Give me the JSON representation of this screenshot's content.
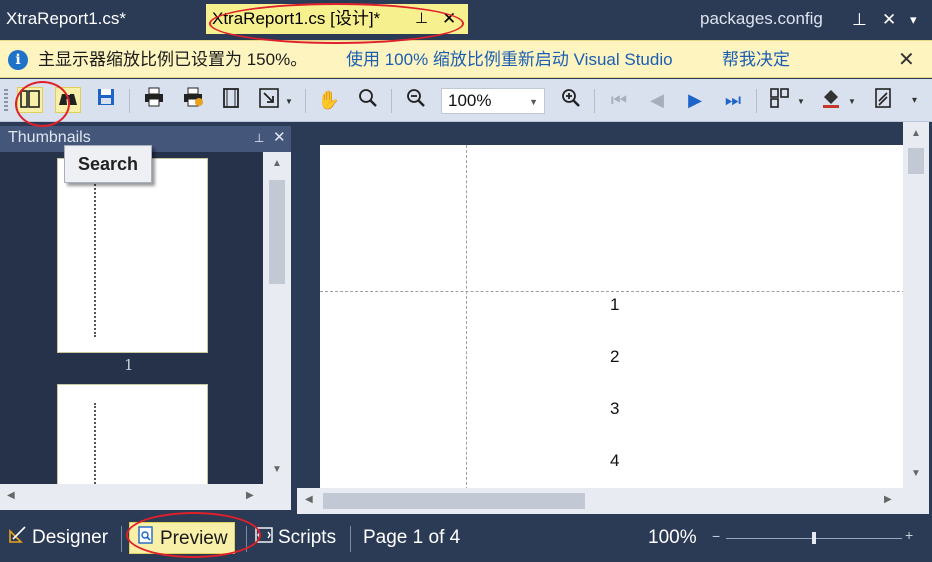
{
  "tabs": [
    {
      "label": "XtraReport1.cs*"
    },
    {
      "label": "XtraReport1.cs [设计]*",
      "pin": "⊥",
      "close": "✕"
    },
    {
      "label": "packages.config"
    }
  ],
  "tabstrip_icons": {
    "pin": "pin-icon",
    "close": "close-icon"
  },
  "infobar": {
    "message": "主显示器缩放比例已设置为 150%。",
    "link1": "使用 100% 缩放比例重新启动 Visual Studio",
    "link2": "帮我决定",
    "close": "✕"
  },
  "toolbar": {
    "zoom_value": "100%",
    "icons": [
      "toggle-thumbnails-icon",
      "search-binoculars-icon",
      "save-icon",
      "print-icon",
      "quick-print-icon",
      "page-setup-icon",
      "scale-icon",
      "hand-tool-icon",
      "magnifier-icon",
      "zoom-out-icon",
      "zoom-combo",
      "zoom-in-icon",
      "first-page-icon",
      "previous-page-icon",
      "next-page-icon",
      "last-page-icon",
      "multiple-pages-icon",
      "background-color-icon",
      "export-icon",
      "overflow-icon"
    ]
  },
  "thumbnails": {
    "title": "Thumbnails",
    "page_label": "1"
  },
  "tooltip": {
    "text": "Search"
  },
  "preview": {
    "rows": [
      "1",
      "2",
      "3",
      "4"
    ]
  },
  "statusbar": {
    "designer": "Designer",
    "preview": "Preview",
    "scripts": "Scripts",
    "page_info": "Page 1 of 4",
    "zoom": "100%",
    "zoom_level": 0.5
  },
  "colors": {
    "active_tab": "#f7f08e",
    "infobar_bg": "#fdf4bf",
    "link": "#1a5fb4",
    "annotation": "#e0202a",
    "chrome_dark": "#2b3a55"
  }
}
